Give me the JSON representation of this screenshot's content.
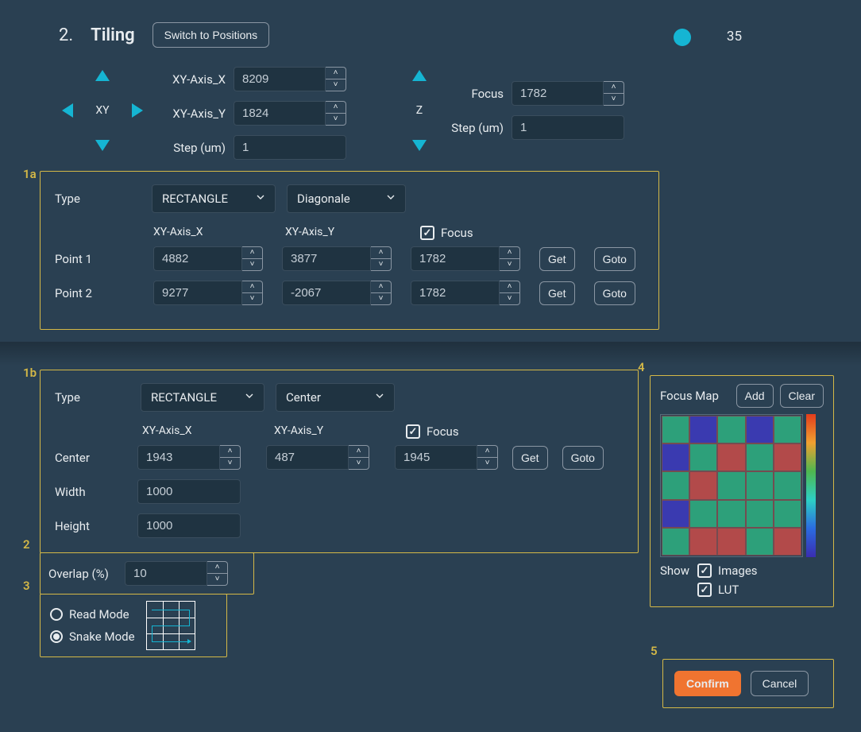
{
  "header": {
    "num": "2.",
    "title": "Tiling",
    "switch_btn": "Switch to Positions"
  },
  "status": {
    "count": "35"
  },
  "nav": {
    "xy_label": "XY",
    "x_label": "XY-Axis_X",
    "x_value": "8209",
    "y_label": "XY-Axis_Y",
    "y_value": "1824",
    "step_label": "Step (um)",
    "step_value": "1",
    "z_label": "Z",
    "focus_label": "Focus",
    "focus_value": "1782",
    "z_step_label": "Step (um)",
    "z_step_value": "1"
  },
  "box1a": {
    "tag": "1a",
    "type_label": "Type",
    "type_value": "RECTANGLE",
    "mode_value": "Diagonale",
    "col_x": "XY-Axis_X",
    "col_y": "XY-Axis_Y",
    "col_focus": "Focus",
    "rows": [
      {
        "label": "Point 1",
        "x": "4882",
        "y": "3877",
        "f": "1782"
      },
      {
        "label": "Point 2",
        "x": "9277",
        "y": "-2067",
        "f": "1782"
      }
    ],
    "get": "Get",
    "goto": "Goto"
  },
  "box1b": {
    "tag": "1b",
    "type_label": "Type",
    "type_value": "RECTANGLE",
    "mode_value": "Center",
    "col_x": "XY-Axis_X",
    "col_y": "XY-Axis_Y",
    "col_focus": "Focus",
    "center_label": "Center",
    "center_x": "1943",
    "center_y": "487",
    "center_f": "1945",
    "width_label": "Width",
    "width_value": "1000",
    "height_label": "Height",
    "height_value": "1000",
    "get": "Get",
    "goto": "Goto"
  },
  "box2": {
    "tag": "2",
    "label": "Overlap (%)",
    "value": "10"
  },
  "box3": {
    "tag": "3",
    "read": "Read Mode",
    "snake": "Snake Mode"
  },
  "box4": {
    "tag": "4",
    "title": "Focus Map",
    "add": "Add",
    "clear": "Clear",
    "show_label": "Show",
    "images": "Images",
    "lut": "LUT",
    "grid": [
      [
        "#2da07a",
        "#3a3ab0",
        "#2da07a",
        "#3a3ab0",
        "#2da07a"
      ],
      [
        "#3a3ab0",
        "#2da07a",
        "#b24a4a",
        "#2da07a",
        "#b24a4a"
      ],
      [
        "#2da07a",
        "#b24a4a",
        "#2da07a",
        "#2da07a",
        "#2da07a"
      ],
      [
        "#3a3ab0",
        "#2da07a",
        "#2da07a",
        "#2da07a",
        "#2da07a"
      ],
      [
        "#2da07a",
        "#b24a4a",
        "#b24a4a",
        "#2da07a",
        "#b24a4a"
      ]
    ]
  },
  "box5": {
    "tag": "5",
    "confirm": "Confirm",
    "cancel": "Cancel"
  }
}
